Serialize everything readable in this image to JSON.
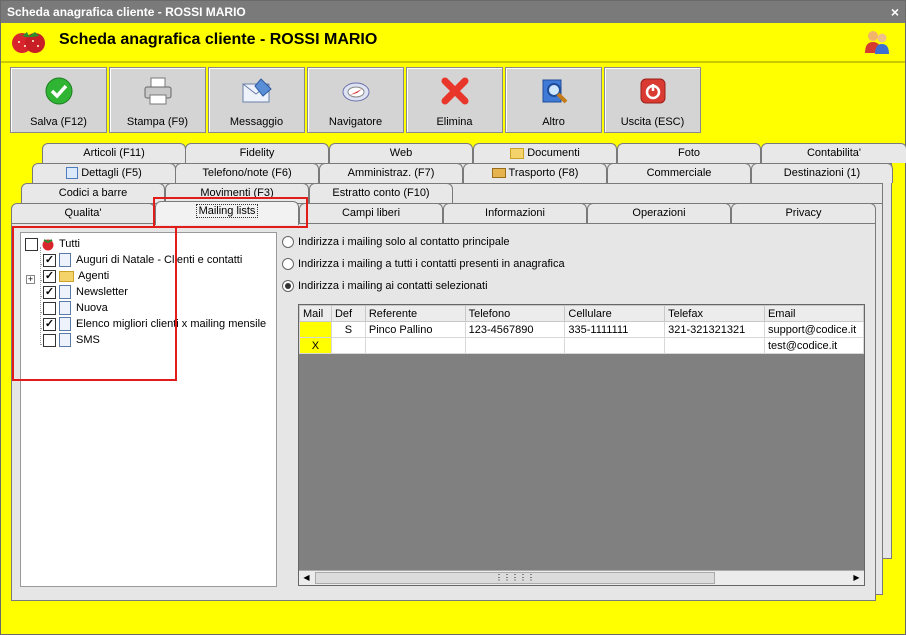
{
  "window": {
    "title": "Scheda anagrafica cliente - ROSSI MARIO",
    "close": "×"
  },
  "header": {
    "title": "Scheda anagrafica cliente - ROSSI MARIO"
  },
  "toolbar": [
    {
      "label": "Salva (F12)",
      "icon": "check-icon"
    },
    {
      "label": "Stampa (F9)",
      "icon": "printer-icon"
    },
    {
      "label": "Messaggio",
      "icon": "envelope-icon"
    },
    {
      "label": "Navigatore",
      "icon": "compass-icon"
    },
    {
      "label": "Elimina",
      "icon": "delete-x-icon"
    },
    {
      "label": "Altro",
      "icon": "search-book-icon"
    },
    {
      "label": "Uscita (ESC)",
      "icon": "power-icon"
    }
  ],
  "tabs": {
    "row1": [
      "Articoli (F11)",
      "Fidelity",
      "Web",
      "Documenti",
      "Foto",
      "Contabilita'"
    ],
    "row2": [
      "Dettagli (F5)",
      "Telefono/note (F6)",
      "Amministraz. (F7)",
      "Trasporto (F8)",
      "Commerciale",
      "Destinazioni (1)"
    ],
    "row3": [
      "Codici a barre",
      "Movimenti (F3)",
      "Estratto conto (F10)"
    ],
    "row4": [
      "Qualita'",
      "Mailing lists",
      "Campi liberi",
      "Informazioni",
      "Operazioni",
      "Privacy"
    ]
  },
  "tree": {
    "root": "Tutti",
    "items": [
      {
        "label": "Auguri di Natale - Clienti e contatti",
        "checked": true,
        "type": "doc"
      },
      {
        "label": "Agenti",
        "checked": true,
        "type": "folder"
      },
      {
        "label": "Newsletter",
        "checked": true,
        "type": "doc"
      },
      {
        "label": "Nuova",
        "checked": false,
        "type": "doc"
      },
      {
        "label": "Elenco migliori clienti x mailing mensile",
        "checked": true,
        "type": "doc"
      },
      {
        "label": "SMS",
        "checked": false,
        "type": "doc"
      }
    ]
  },
  "options": [
    {
      "label": "Indirizza i mailing solo al contatto principale",
      "selected": false
    },
    {
      "label": "Indirizza i mailing a tutti i contatti presenti in anagrafica",
      "selected": false
    },
    {
      "label": "Indirizza i mailing ai contatti selezionati",
      "selected": true
    }
  ],
  "grid": {
    "columns": [
      "Mail",
      "Def",
      "Referente",
      "Telefono",
      "Cellulare",
      "Telefax",
      "Email"
    ],
    "rows": [
      [
        "",
        "S",
        "Pinco Pallino",
        "123-4567890",
        "335-1111111",
        "321-321321321",
        "support@codice.it"
      ],
      [
        "X",
        "",
        "",
        "",
        "",
        "",
        "test@codice.it"
      ]
    ]
  },
  "colors": {
    "background": "#ffff00",
    "highlight": "#e21b1b",
    "titlebar": "#7a7a7a"
  }
}
